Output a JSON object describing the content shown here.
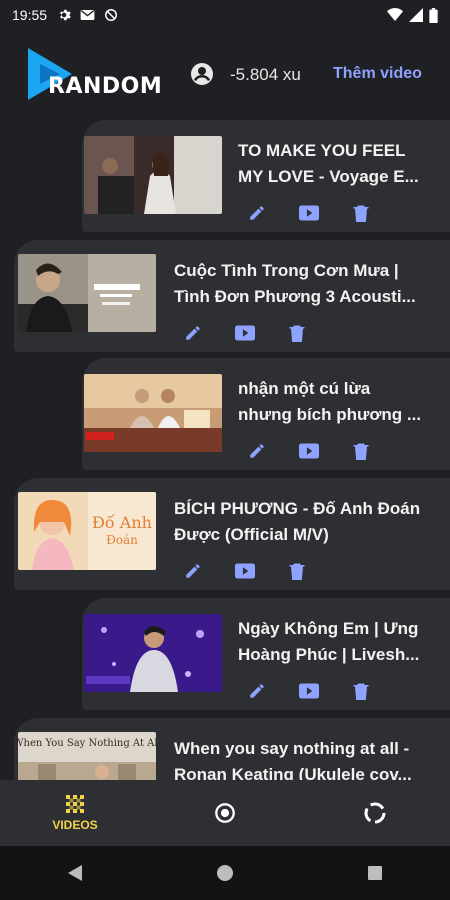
{
  "status_bar": {
    "time": "19:55"
  },
  "header": {
    "logo_text": "RANDOM",
    "balance": "-5.804 xu",
    "add_video_label": "Thêm video"
  },
  "videos": [
    {
      "title_line1": "TO MAKE YOU FEEL",
      "title_line2": "MY LOVE - Voyage E..."
    },
    {
      "title_line1": "Cuộc Tình Trong Cơn Mưa |",
      "title_line2": "Tình Đơn Phương 3 Acousti..."
    },
    {
      "title_line1": "nhận một cú lừa",
      "title_line2": "nhưng bích phương ..."
    },
    {
      "title_line1": "BÍCH PHƯƠNG - Đố Anh Đoán",
      "title_line2": "Được (Official M/V)"
    },
    {
      "title_line1": "Ngày Không Em | Ưng",
      "title_line2": "Hoàng Phúc | Livesh..."
    },
    {
      "title_line1": "When you say nothing at all -",
      "title_line2": "Ronan Keating (Ukulele cov..."
    }
  ],
  "bottom_nav": {
    "videos_label": "VIDEOS"
  },
  "colors": {
    "accent": "#8ea2ff",
    "nav_active": "#f0d24a",
    "card_bg": "#2e2f33",
    "page_bg": "#1f2023"
  }
}
